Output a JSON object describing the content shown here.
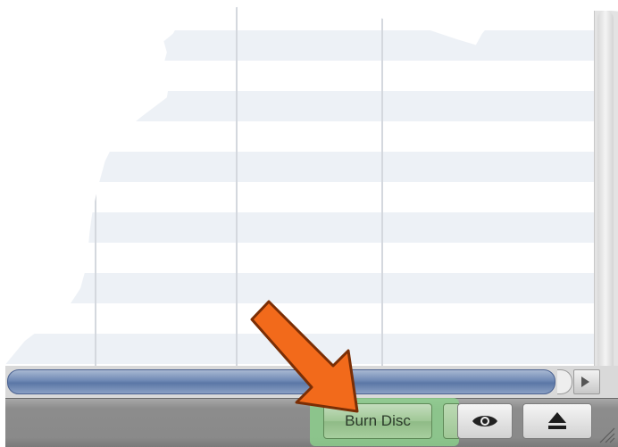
{
  "toolbar": {
    "burn_disc_label": "Burn Disc",
    "buttons": [
      {
        "name": "preview",
        "icon": "eye-icon"
      },
      {
        "name": "eject",
        "icon": "eject-icon"
      }
    ]
  },
  "annotation": {
    "arrow_color": "#f26a1b",
    "highlight_color": "#8cd28c"
  },
  "list": {
    "stripe_color": "#edf1f6",
    "columns": 3
  }
}
